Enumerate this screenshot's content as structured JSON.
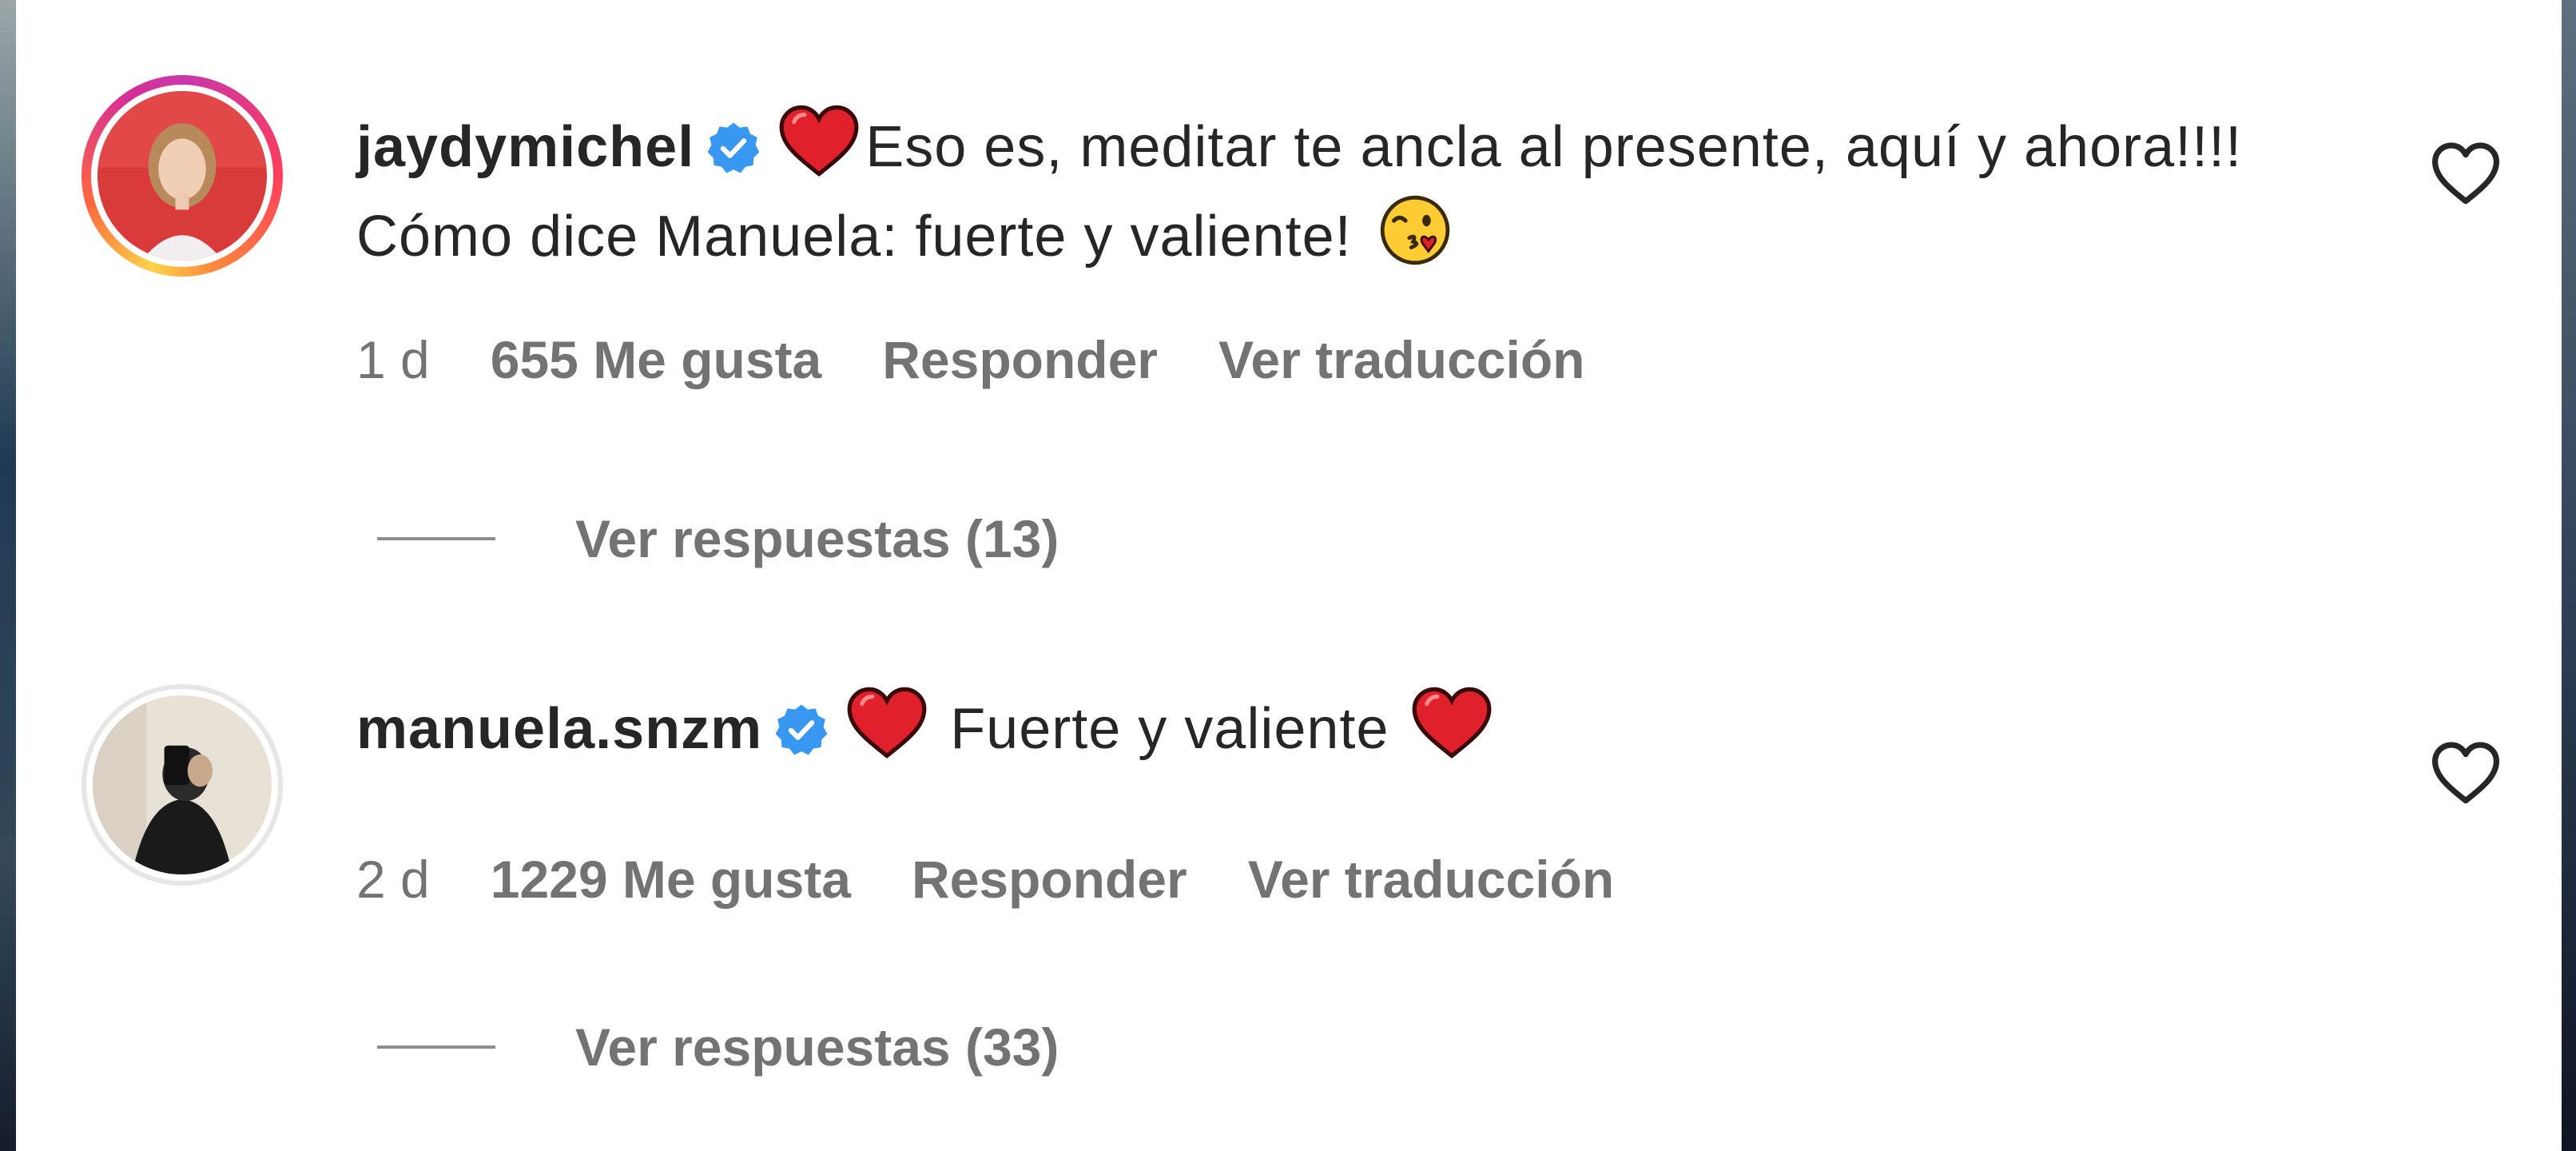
{
  "comments": [
    {
      "username": "jaydymichel",
      "text": "Eso es, meditar te ancla al presente, aquí y ahora!!!! Cómo dice Manuela: fuerte y valiente!",
      "time": "1 d",
      "likes": "655 Me gusta",
      "reply_label": "Responder",
      "translate_label": "Ver traducción",
      "replies_label": "Ver respuestas (13)",
      "emoji_lead": "red-heart",
      "emoji_trail": "face-blowing-kiss"
    },
    {
      "username": "manuela.snzm",
      "text": "Fuerte y valiente",
      "time": "2 d",
      "likes": "1229 Me gusta",
      "reply_label": "Responder",
      "translate_label": "Ver traducción",
      "replies_label": "Ver respuestas (33)",
      "emoji_lead": "red-heart",
      "emoji_trail": "red-heart"
    }
  ],
  "colors": {
    "text_primary": "#262626",
    "text_secondary": "#737373",
    "verified_blue": "#3897f0",
    "heart_red": "#e0202a"
  }
}
